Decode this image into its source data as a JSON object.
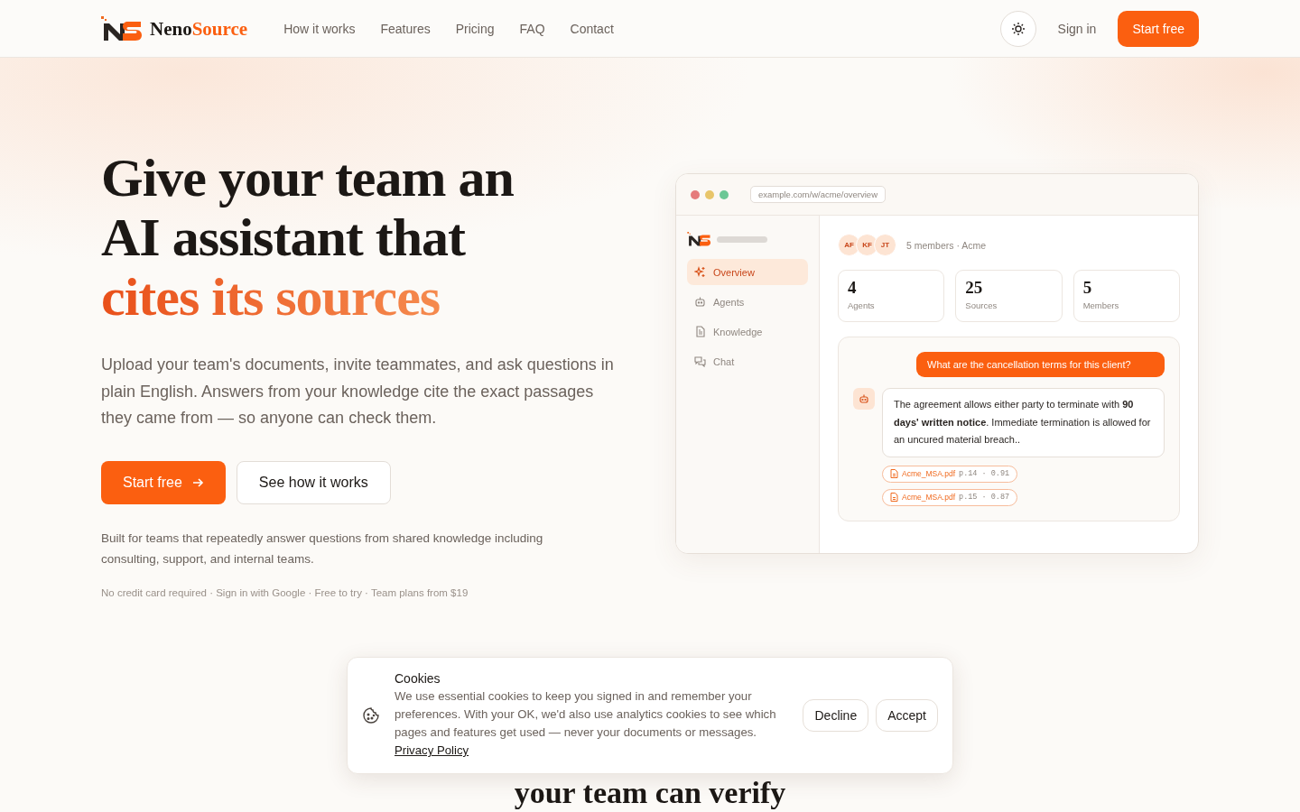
{
  "header": {
    "brand": {
      "part1": "Neno",
      "part2": "Source"
    },
    "nav": [
      {
        "label": "How it works"
      },
      {
        "label": "Features"
      },
      {
        "label": "Pricing"
      },
      {
        "label": "FAQ"
      },
      {
        "label": "Contact"
      }
    ],
    "sign_in": "Sign in",
    "cta": "Start free"
  },
  "hero": {
    "headline_lines": [
      "Give your team an",
      "AI assistant that"
    ],
    "headline_highlight": "cites its sources",
    "lead": "Upload your team's documents, invite teammates, and ask questions in plain English. Answers from your knowledge cite the exact passages they came from — so anyone can check them.",
    "primary_button": "Start free",
    "secondary_button": "See how it works",
    "audience": "Built for teams that repeatedly answer questions from shared knowledge including consulting, support, and internal teams.",
    "fine_print": "No credit card required · Sign in with Google · Free to try · Team plans from $19"
  },
  "mockup": {
    "url": "example.com/w/acme/overview",
    "sidebar": [
      {
        "label": "Overview",
        "selected": true
      },
      {
        "label": "Agents",
        "selected": false
      },
      {
        "label": "Knowledge",
        "selected": false
      },
      {
        "label": "Chat",
        "selected": false
      }
    ],
    "avatars": [
      "AF",
      "KF",
      "JT"
    ],
    "members_text": "5 members · Acme",
    "stats": [
      {
        "value": "4",
        "label": "Agents"
      },
      {
        "value": "25",
        "label": "Sources"
      },
      {
        "value": "5",
        "label": "Members"
      }
    ],
    "question": "What are the cancellation terms for this client?",
    "answer": "The agreement allows either party to terminate with **90 days' written notice**. Immediate termination is allowed for an uncured material breach..",
    "citations": [
      {
        "file": "Acme_MSA.pdf",
        "meta": "p.14 · 0.91"
      },
      {
        "file": "Acme_MSA.pdf",
        "meta": "p.15 · 0.87"
      }
    ]
  },
  "next_section_heading": "your team can verify",
  "cookie_banner": {
    "title": "Cookies",
    "text": "We use essential cookies to keep you signed in and remember your preferences. With your OK, we'd also use analytics cookies to see which pages and features get used — never your documents or messages.",
    "link": "Privacy Policy",
    "buttons": [
      "Decline",
      "Accept"
    ]
  }
}
